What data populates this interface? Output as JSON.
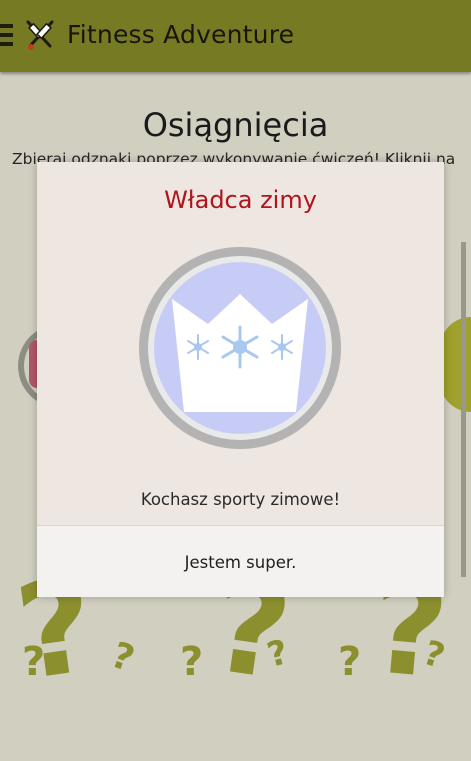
{
  "app": {
    "title": "Fitness Adventure",
    "menu_icon": "hamburger-menu-icon",
    "logo_icon": "crossed-swords-icon"
  },
  "page": {
    "title": "Osiągnięcia",
    "subtitle": "Zbieraj odznaki poprzez wykonywanie ćwiczeń! Kliknij na"
  },
  "dialog": {
    "title": "Władca zimy",
    "badge_icon": "snowflake-crown-icon",
    "message": "Kochasz sporty zimowe!",
    "button_label": "Jestem super."
  },
  "locked_badges": [
    "?",
    "?",
    "?"
  ],
  "colors": {
    "action_bar": "#767a22",
    "dialog_title": "#b0141e",
    "badge_ring": "#b3b3b3",
    "badge_fill": "#c7ccf7",
    "question_mark": "#8c8f2e"
  }
}
